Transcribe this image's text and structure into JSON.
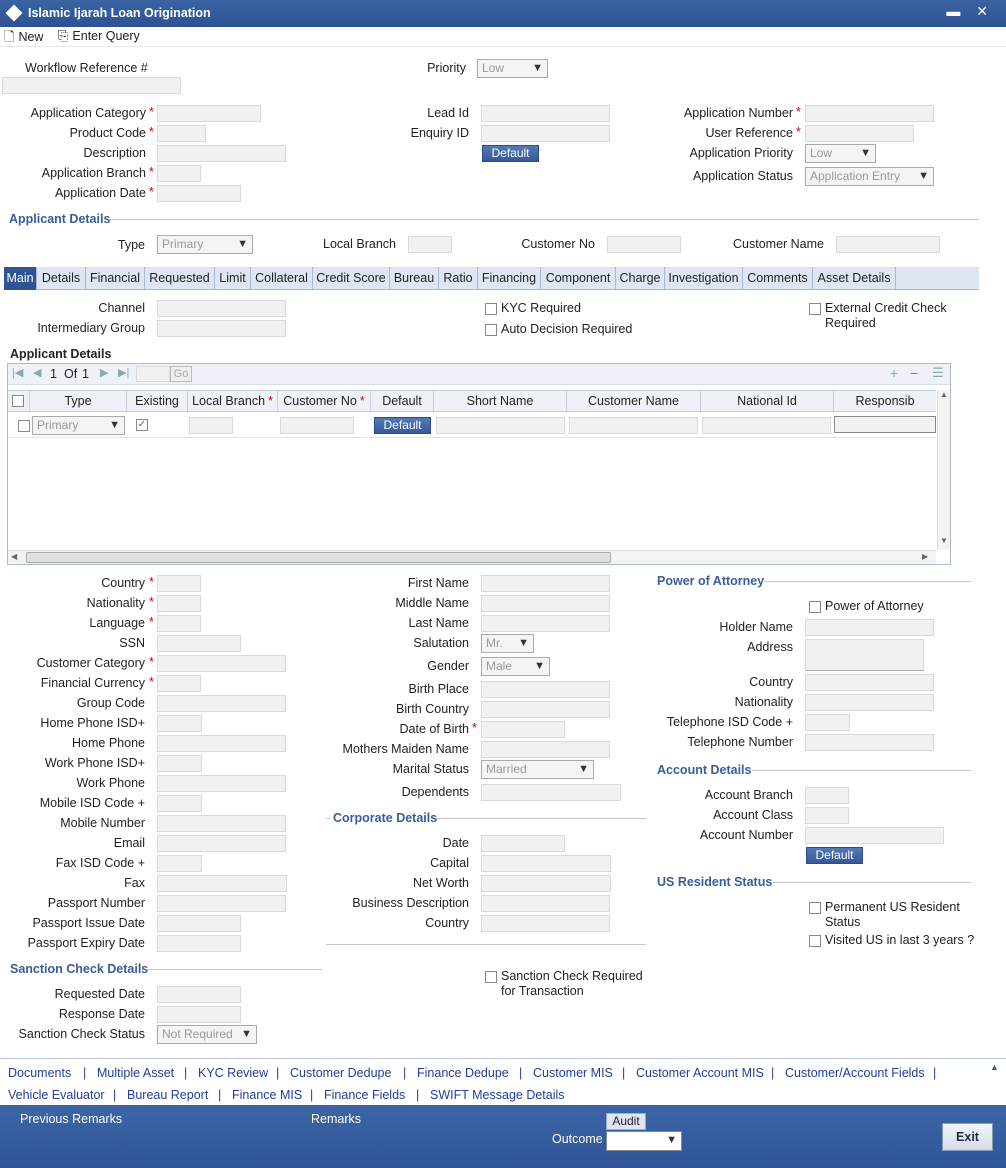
{
  "window": {
    "title": "Islamic Ijarah Loan Origination",
    "controls": "▬ ✕"
  },
  "toolbar": {
    "new_label": "New",
    "enter_query_label": "Enter Query"
  },
  "header": {
    "workflow_ref_label": "Workflow Reference #",
    "priority_label": "Priority",
    "priority_value": "Low",
    "application_category_label": "Application Category",
    "product_code_label": "Product Code",
    "description_label": "Description",
    "application_branch_label": "Application Branch",
    "application_date_label": "Application Date",
    "lead_id_label": "Lead Id",
    "enquiry_id_label": "Enquiry ID",
    "default_label": "Default",
    "application_number_label": "Application Number",
    "user_reference_label": "User Reference",
    "application_priority_label": "Application Priority",
    "application_priority_value": "Low",
    "application_status_label": "Application Status",
    "application_status_value": "Application Entry",
    "required_mark": "*"
  },
  "applicant": {
    "section_title": "Applicant Details",
    "type_label": "Type",
    "type_value": "Primary",
    "local_branch_label": "Local Branch",
    "customer_no_label": "Customer No",
    "customer_name_label": "Customer Name"
  },
  "tabs": [
    "Main",
    "Details",
    "Financial",
    "Requested",
    "Limit",
    "Collateral",
    "Credit Score",
    "Bureau",
    "Ratio",
    "Financing",
    "Component",
    "Charge",
    "Investigation",
    "Comments",
    "Asset Details"
  ],
  "main": {
    "channel_label": "Channel",
    "intermediary_group_label": "Intermediary Group",
    "kyc_required_label": "KYC Required",
    "auto_decision_label": "Auto Decision Required",
    "external_credit_label_1": "External Credit Check",
    "external_credit_label_2": "Required",
    "applicant_grid_title": "Applicant Details"
  },
  "grid": {
    "page_current": "1",
    "page_of": "Of",
    "page_total": "1",
    "go_label": "Go",
    "columns": [
      "Type",
      "Existing",
      "Local Branch",
      "Customer No",
      "Default",
      "Short Name",
      "Customer Name",
      "National Id",
      "Responsib"
    ],
    "row": {
      "type": "Primary",
      "default_label": "Default"
    }
  },
  "personal": {
    "left": [
      {
        "label": "Country",
        "req": true
      },
      {
        "label": "Nationality",
        "req": true
      },
      {
        "label": "Language",
        "req": true
      },
      {
        "label": "SSN",
        "req": false
      },
      {
        "label": "Customer Category",
        "req": true
      },
      {
        "label": "Financial Currency",
        "req": true
      },
      {
        "label": "Group Code",
        "req": false
      },
      {
        "label": "Home Phone ISD+",
        "req": false
      },
      {
        "label": "Home Phone",
        "req": false
      },
      {
        "label": "Work Phone ISD+",
        "req": false
      },
      {
        "label": "Work Phone",
        "req": false
      },
      {
        "label": "Mobile ISD Code +",
        "req": false
      },
      {
        "label": "Mobile Number",
        "req": false
      },
      {
        "label": "Email",
        "req": false
      },
      {
        "label": "Fax ISD Code +",
        "req": false
      },
      {
        "label": "Fax",
        "req": false
      },
      {
        "label": "Passport Number",
        "req": false
      },
      {
        "label": "Passport Issue Date",
        "req": false
      },
      {
        "label": "Passport Expiry Date",
        "req": false
      }
    ],
    "first_name_label": "First Name",
    "middle_name_label": "Middle Name",
    "last_name_label": "Last Name",
    "salutation_label": "Salutation",
    "salutation_value": "Mr.",
    "gender_label": "Gender",
    "gender_value": "Male",
    "birth_place_label": "Birth Place",
    "birth_country_label": "Birth Country",
    "dob_label": "Date of Birth",
    "mothers_maiden_label": "Mothers Maiden Name",
    "marital_status_label": "Marital Status",
    "marital_status_value": "Married",
    "dependents_label": "Dependents"
  },
  "corporate": {
    "section_title": "Corporate Details",
    "date_label": "Date",
    "capital_label": "Capital",
    "net_worth_label": "Net Worth",
    "business_desc_label": "Business Description",
    "country_label": "Country"
  },
  "poa": {
    "section_title": "Power of Attorney",
    "checkbox_label": "Power of Attorney",
    "holder_name_label": "Holder Name",
    "address_label": "Address",
    "country_label": "Country",
    "nationality_label": "Nationality",
    "tel_isd_label": "Telephone ISD Code +",
    "tel_number_label": "Telephone Number"
  },
  "account": {
    "section_title": "Account Details",
    "branch_label": "Account Branch",
    "class_label": "Account Class",
    "number_label": "Account Number",
    "default_label": "Default"
  },
  "us_resident": {
    "section_title": "US Resident Status",
    "permanent_label_1": "Permanent US Resident",
    "permanent_label_2": "Status",
    "visited_label": "Visited US in last 3 years ?"
  },
  "sanction": {
    "section_title": "Sanction Check Details",
    "requested_date_label": "Requested Date",
    "response_date_label": "Response Date",
    "status_label": "Sanction Check Status",
    "status_value": "Not Required",
    "required_label_1": "Sanction Check Required",
    "required_label_2": "for Transaction"
  },
  "bottom_links": {
    "row1": [
      "Documents",
      "Multiple Asset",
      "KYC Review",
      "Customer Dedupe",
      "Finance Dedupe",
      "Customer MIS",
      "Customer Account MIS",
      "Customer/Account Fields"
    ],
    "row2": [
      "Vehicle Evaluator",
      "Bureau Report",
      "Finance MIS",
      "Finance Fields",
      "SWIFT Message Details"
    ]
  },
  "footer": {
    "previous_remarks_label": "Previous Remarks",
    "remarks_label": "Remarks",
    "audit_label": "Audit",
    "outcome_label": "Outcome",
    "exit_label": "Exit"
  }
}
